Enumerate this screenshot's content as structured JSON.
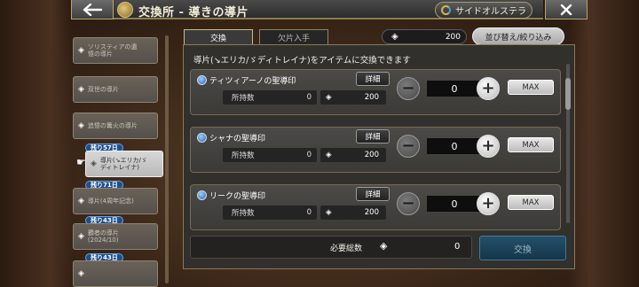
{
  "header": {
    "back_icon": "back-arrow-icon",
    "title": "交換所 - 導きの導片",
    "side_button_label": "サイドオルステラ",
    "close_icon": "close-icon"
  },
  "sidebar": {
    "items": [
      {
        "label": "ソリスティアの遺\n憶の導片",
        "badge": ""
      },
      {
        "label": "双世の導片",
        "badge": ""
      },
      {
        "label": "追憶の篝火の導片",
        "badge": ""
      },
      {
        "label": "導片(↘エリカ/ゞ\nディトレイナ)",
        "badge": "残り57日",
        "selected": true
      },
      {
        "label": "導片(4周年記念)",
        "badge": "残り71日"
      },
      {
        "label": "覇者の導片\n(2024/10)",
        "badge": "残り43日"
      },
      {
        "label": "",
        "badge": "残り43日"
      }
    ]
  },
  "tabs": {
    "exchange": "交換",
    "fragment_get": "欠片入手"
  },
  "currency": {
    "value": "200"
  },
  "sort_filter_label": "並び替え/絞り込み",
  "info_text": "導片(↘エリカ/ゞディトレイナ)をアイテムに交換できます",
  "items": [
    {
      "name": "ティツィアーノの聖導印",
      "detail": "詳細",
      "owned_label": "所持数",
      "owned": "0",
      "cost": "200",
      "qty": "0",
      "max": "MAX"
    },
    {
      "name": "シャナの聖導印",
      "detail": "詳細",
      "owned_label": "所持数",
      "owned": "0",
      "cost": "200",
      "qty": "0",
      "max": "MAX"
    },
    {
      "name": "リークの聖導印",
      "detail": "詳細",
      "owned_label": "所持数",
      "owned": "0",
      "cost": "200",
      "qty": "0",
      "max": "MAX"
    }
  ],
  "footer": {
    "required_label": "必要総数",
    "required_value": "0",
    "exchange_label": "交換"
  }
}
